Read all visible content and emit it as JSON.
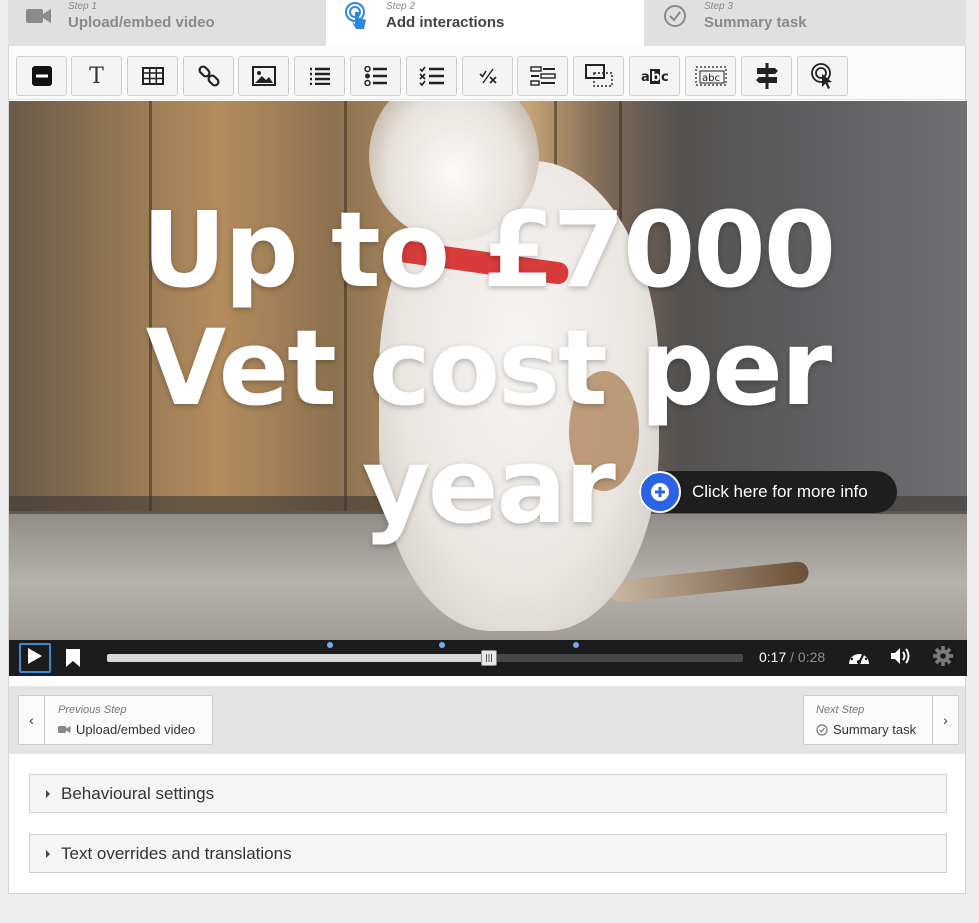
{
  "steps": [
    {
      "number": "Step 1",
      "name": "Upload/embed video",
      "icon": "video-camera-icon"
    },
    {
      "number": "Step 2",
      "name": "Add interactions",
      "icon": "touch-icon",
      "active": true
    },
    {
      "number": "Step 3",
      "name": "Summary task",
      "icon": "check-circle-icon"
    }
  ],
  "toolbar": {
    "tools": [
      "label-icon",
      "text-icon",
      "table-icon",
      "link-icon",
      "image-icon",
      "statements-icon",
      "single-choice-icon",
      "multiple-choice-icon",
      "true-false-icon",
      "drag-text-icon",
      "drag-drop-icon",
      "mark-words-icon",
      "fill-blanks-icon",
      "navigation-hotspot-icon",
      "crossroads-icon"
    ],
    "text_tool_glyph": "T"
  },
  "video": {
    "overlay_lines": [
      "Up to £7000",
      "Vet cost per",
      "year"
    ],
    "hotspot_label": "Click here for more info",
    "progress": 0.6,
    "markers": [
      0.35,
      0.526,
      0.737
    ],
    "time_current": "0:17",
    "time_separator": "/",
    "time_total": "0:28",
    "control_icons": [
      "play-icon",
      "bookmark-icon",
      "speed-icon",
      "volume-icon",
      "settings-icon"
    ]
  },
  "navigation": {
    "previous": {
      "caption": "Previous Step",
      "label": "Upload/embed video"
    },
    "next": {
      "caption": "Next Step",
      "label": "Summary task"
    }
  },
  "settings": {
    "behavioural": "Behavioural settings",
    "text_overrides": "Text overrides and translations"
  },
  "colors": {
    "accent_blue": "#2b63e3",
    "focus_blue": "#3a8bd6",
    "controls_bg": "#1c1c1c"
  }
}
